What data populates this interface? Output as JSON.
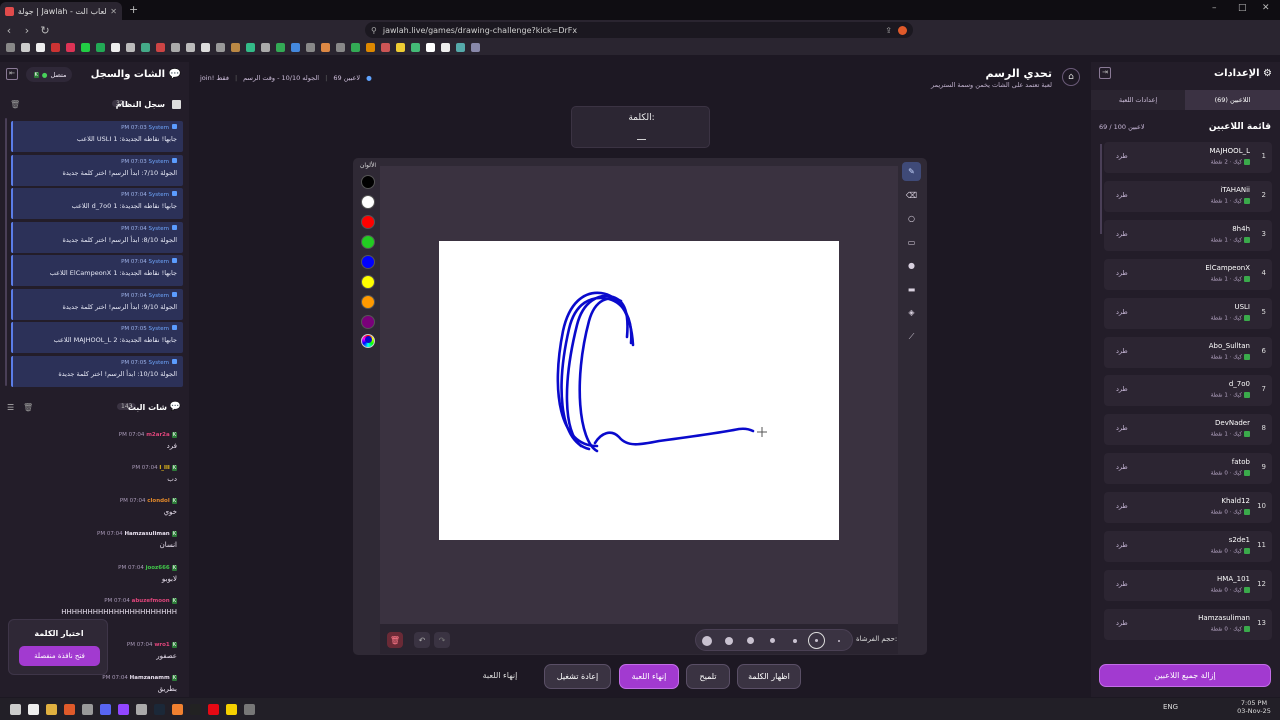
{
  "browser": {
    "tab_title": "جولة | Jawlah - منصة الألعاب الت...",
    "url": "jawlah.live/games/drawing-challenge?kick=DrFx"
  },
  "header": {
    "title": "تحدي الرسم",
    "subtitle": "لعبة تعتمد على الشات يخمن وسمة الستريمر",
    "players": "69 لاعبين",
    "round": "الجوله 10/10 - وقت الرسم",
    "mode": "join! فقط"
  },
  "left": {
    "title": "الشات والسجل",
    "status": "متصل",
    "system_log": {
      "title": "سجل النظام",
      "count": "32",
      "messages": [
        {
          "meta": "System",
          "time": "PM 07:03",
          "text": "اللاعب USLI جابها! نقاطه الجديدة: 1"
        },
        {
          "meta": "System",
          "time": "PM 07:03",
          "text": "الجولة 7/10: ابدأ الرسم! اختر كلمة جديدة"
        },
        {
          "meta": "System",
          "time": "PM 07:04",
          "text": "اللاعب d_7o0 جابها! نقاطه الجديدة: 1"
        },
        {
          "meta": "System",
          "time": "PM 07:04",
          "text": "الجولة 8/10: ابدأ الرسم! اختر كلمة جديدة"
        },
        {
          "meta": "System",
          "time": "PM 07:04",
          "text": "اللاعب ElCampeonX جابها! نقاطه الجديدة: 1"
        },
        {
          "meta": "System",
          "time": "PM 07:04",
          "text": "الجولة 9/10: ابدأ الرسم! اختر كلمة جديدة"
        },
        {
          "meta": "System",
          "time": "PM 07:05",
          "text": "اللاعب MAJHOOL_L جابها! نقاطه الجديدة: 2"
        },
        {
          "meta": "System",
          "time": "PM 07:05",
          "text": "الجولة 10/10: ابدأ الرسم! اختر كلمة جديدة"
        }
      ]
    },
    "live_chat": {
      "title": "شات البث",
      "count": "143",
      "messages": [
        {
          "name": "m2ar2a",
          "time": "PM 07:04",
          "text": "فرد",
          "color": "#e0457b"
        },
        {
          "name": "l_lll",
          "time": "PM 07:04",
          "text": "دب",
          "color": "#f0c419"
        },
        {
          "name": "clondol",
          "time": "PM 07:04",
          "text": "خوي",
          "color": "#e58a2a"
        },
        {
          "name": "Hamzasuliman",
          "time": "PM 07:04",
          "text": "انسان",
          "color": "#e8e0ee"
        },
        {
          "name": "jooz666",
          "time": "PM 07:04",
          "text": "لابوبو",
          "color": "#41c84a"
        },
        {
          "name": "abuzefmoon",
          "time": "PM 07:04",
          "text": "HHHHHHHHHHHHHHHHHHHHHH",
          "color": "#e0457b"
        },
        {
          "name": "wro1",
          "time": "PM 07:04",
          "text": "عصفور",
          "color": "#e0457b"
        },
        {
          "name": "Hamzanamm",
          "time": "PM 07:04",
          "text": "بطريق",
          "color": "#e8e0ee"
        }
      ]
    },
    "word_choice": {
      "title": "اختيار الكلمة",
      "button": "فتح نافذة منفصلة"
    }
  },
  "center": {
    "word_label": "الكلمة:",
    "word_value": "__",
    "colors_label": "الألوان",
    "brush_label": "حجم الفرشاة:",
    "palette": [
      "#000000",
      "#ffffff",
      "#ff0000",
      "#22cc22",
      "#0000ff",
      "#ffff00",
      "#ff9900",
      "#7a007a"
    ],
    "stroke_color": "#0a0acc",
    "actions": {
      "reveal": "اظهار الكلمة",
      "hint": "تلميح",
      "end_game": "إنهاء اللعبة",
      "restart": "إعادة تشغيل",
      "end_game2": "إنهاء اللعبة"
    }
  },
  "right": {
    "title": "الإعدادات",
    "tab_players": "اللاعبين (69)",
    "tab_settings": "إعدادات اللعبة",
    "list_title": "قائمة اللاعبين",
    "list_count": "69 / 100 لاعبين",
    "kick_label": "طرد",
    "remove_all": "إزالة جميع اللاعبين",
    "players": [
      {
        "rank": "1",
        "name": "MAJHOOL_L",
        "points": "كيك · 2 نقطة"
      },
      {
        "rank": "2",
        "name": "iTAHANii",
        "points": "كيك · 1 نقطة"
      },
      {
        "rank": "3",
        "name": "8h4h",
        "points": "كيك · 1 نقطة"
      },
      {
        "rank": "4",
        "name": "ElCampeonX",
        "points": "كيك · 1 نقطة"
      },
      {
        "rank": "5",
        "name": "USLI",
        "points": "كيك · 1 نقطة"
      },
      {
        "rank": "6",
        "name": "Abo_Sulltan",
        "points": "كيك · 1 نقطة"
      },
      {
        "rank": "7",
        "name": "d_7o0",
        "points": "كيك · 1 نقطة"
      },
      {
        "rank": "8",
        "name": "DevNader",
        "points": "كيك · 1 نقطة"
      },
      {
        "rank": "9",
        "name": "fatob",
        "points": "كيك · 0 نقطة"
      },
      {
        "rank": "10",
        "name": "Khald12",
        "points": "كيك · 0 نقطة"
      },
      {
        "rank": "11",
        "name": "s2de1",
        "points": "كيك · 0 نقطة"
      },
      {
        "rank": "12",
        "name": "HMA_101",
        "points": "كيك · 0 نقطة"
      },
      {
        "rank": "13",
        "name": "Hamzasuliman",
        "points": "كيك · 0 نقطة"
      }
    ]
  },
  "taskbar": {
    "lang": "ENG",
    "time": "7:05 PM",
    "date": "03-Nov-25"
  }
}
